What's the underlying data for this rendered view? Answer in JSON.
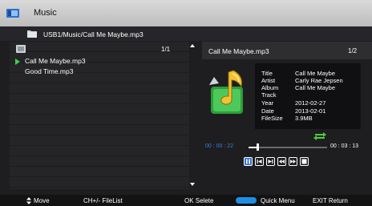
{
  "window": {
    "title": "Music"
  },
  "path": {
    "text": "USB1/Music/Call Me Maybe.mp3"
  },
  "file_list": {
    "page": "1/1",
    "items": [
      {
        "label": "Call Me Maybe.mp3",
        "playing": true
      },
      {
        "label": "Good Time.mp3",
        "playing": false
      }
    ]
  },
  "now_playing": {
    "title": "Call Me Maybe.mp3",
    "count": "1/2",
    "info": [
      {
        "key": "Title",
        "value": "Call Me Maybe"
      },
      {
        "key": "Artist",
        "value": "Carly Rae Jepsen"
      },
      {
        "key": "Album",
        "value": "Call Me Maybe"
      },
      {
        "key": "Track",
        "value": ""
      },
      {
        "key": "Year",
        "value": "2012-02-27"
      },
      {
        "key": "Date",
        "value": "2013-02-01"
      },
      {
        "key": "FileSize",
        "value": "3.9MB"
      }
    ],
    "time_current": "00 : 00 : 22",
    "time_total": "00 : 03 : 13",
    "progress_fraction": 0.114
  },
  "controls": [
    {
      "icon": "pause-icon",
      "active": true
    },
    {
      "icon": "previous-icon",
      "active": false
    },
    {
      "icon": "next-icon",
      "active": false
    },
    {
      "icon": "rewind-icon",
      "active": false
    },
    {
      "icon": "fast-forward-icon",
      "active": false
    },
    {
      "icon": "stop-icon",
      "active": false
    }
  ],
  "footer": {
    "move": "Move",
    "filelist": "CH+/-  FileList",
    "ok": "OK  Selete",
    "quick_menu": "Quick Menu",
    "exit": "EXIT  Return"
  },
  "colors": {
    "accent_blue": "#2f6fd0",
    "quick_menu_key": "#1f8fe5",
    "play_indicator": "#3bd14a",
    "repeat_icon": "#4ccc3a",
    "time_current": "#3a7de0"
  }
}
